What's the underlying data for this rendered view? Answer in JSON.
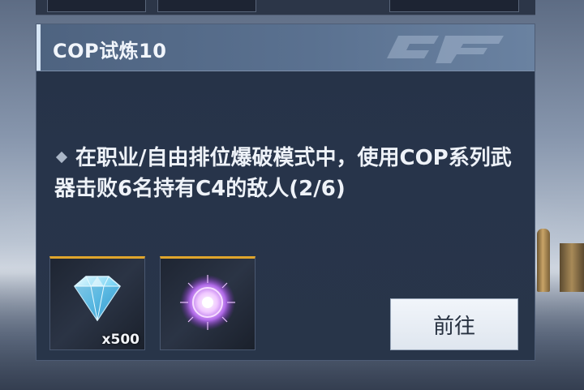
{
  "task": {
    "title": "COP试炼10",
    "description": "在职业/自由排位爆破模式中，使用COP系列武器击败6名持有C4的敌人(2/6)"
  },
  "rewards": [
    {
      "icon": "diamond-icon",
      "quantity": "x500"
    },
    {
      "icon": "energy-orb-icon",
      "quantity": ""
    }
  ],
  "actions": {
    "go_label": "前往"
  },
  "colors": {
    "header": "#5a7190",
    "card": "#27344a",
    "reward_border_top": "#e0a52c",
    "button": "#e8eef5"
  }
}
